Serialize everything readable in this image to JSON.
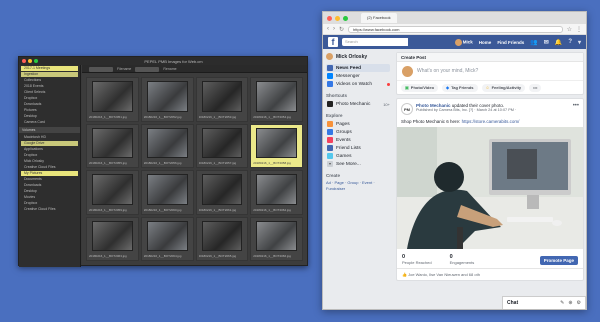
{
  "photo_mechanic": {
    "title": "PEPEL PMB Images for Web.cm",
    "toolbar": [
      "Filename",
      "Rename"
    ],
    "sidebar": [
      {
        "label": "2017-1 Meetings",
        "state": "sel"
      },
      {
        "label": "Ingestion",
        "state": "hl"
      },
      {
        "label": "Collections",
        "state": ""
      },
      {
        "label": "2018 Events",
        "state": ""
      },
      {
        "label": "Client Selects",
        "state": ""
      },
      {
        "label": "Dropbox",
        "state": ""
      },
      {
        "label": "Downloads",
        "state": ""
      },
      {
        "label": "Pictures",
        "state": ""
      },
      {
        "label": "Desktop",
        "state": ""
      },
      {
        "label": "Camera Card",
        "state": ""
      }
    ],
    "sidebar2_header": "Volumes",
    "sidebar2": [
      {
        "label": "Macintosh HD",
        "state": ""
      },
      {
        "label": "Google Drive",
        "state": "hl"
      },
      {
        "label": "Applications",
        "state": ""
      },
      {
        "label": "Dropbox",
        "state": ""
      },
      {
        "label": "Mick Orlosky",
        "state": ""
      },
      {
        "label": "Creative Cloud Files",
        "state": ""
      },
      {
        "label": "My Pictures",
        "state": "sel"
      },
      {
        "label": "Documents",
        "state": ""
      },
      {
        "label": "Downloads",
        "state": ""
      },
      {
        "label": "Desktop",
        "state": ""
      },
      {
        "label": "Movies",
        "state": ""
      },
      {
        "label": "Dropbox",
        "state": ""
      },
      {
        "label": "Creative Cloud Files",
        "state": ""
      }
    ],
    "thumbnails": [
      {
        "cap": "20180216_1__BOT2051.jpg",
        "hl": false
      },
      {
        "cap": "20180216_1__BOT2052.jpg",
        "hl": false
      },
      {
        "cap": "20180216_1__BOT2053.jpg",
        "hl": false
      },
      {
        "cap": "20180216_1__BOT2054.jpg",
        "hl": false
      },
      {
        "cap": "20180216_1__BOT2055.jpg",
        "hl": false
      },
      {
        "cap": "20180216_1__BOT2056.jpg",
        "hl": false
      },
      {
        "cap": "20180216_1__BOT2057.jpg",
        "hl": false
      },
      {
        "cap": "20180216_1__BOT2058.jpg",
        "hl": true
      },
      {
        "cap": "20180216_1__BOT2059.jpg",
        "hl": false
      },
      {
        "cap": "20180216_1__BOT2060.jpg",
        "hl": false
      },
      {
        "cap": "20180216_1__BOT2061.jpg",
        "hl": false
      },
      {
        "cap": "20180216_1__BOT2062.jpg",
        "hl": false
      },
      {
        "cap": "20180216_1__BOT2063.jpg",
        "hl": false
      },
      {
        "cap": "20180216_1__BOT2064.jpg",
        "hl": false
      },
      {
        "cap": "20180216_1__BOT2065.jpg",
        "hl": false
      },
      {
        "cap": "20180216_1__BOT2066.jpg",
        "hl": false
      }
    ]
  },
  "browser": {
    "tab_title": "(2) Facebook",
    "url": "https://www.facebook.com"
  },
  "facebook": {
    "search_placeholder": "Search",
    "nav": {
      "user": "Mick",
      "home": "Home",
      "find_friends": "Find Friends"
    },
    "left": {
      "user": "Mick Orlosky",
      "items": [
        {
          "label": "News Feed",
          "color": "#4267b2",
          "sel": true
        },
        {
          "label": "Messenger",
          "color": "#0084ff",
          "sel": false
        },
        {
          "label": "Videos on Watch",
          "color": "#3578e5",
          "sel": false,
          "dot": true
        }
      ],
      "shortcuts_header": "Shortcuts",
      "shortcuts": [
        {
          "label": "Photo Mechanic",
          "color": "#222",
          "extra": "10+"
        }
      ],
      "explore_header": "Explore",
      "explore": [
        {
          "label": "Pages",
          "color": "#f7923b"
        },
        {
          "label": "Groups",
          "color": "#3578e5"
        },
        {
          "label": "Events",
          "color": "#f3425f"
        },
        {
          "label": "Friend Lists",
          "color": "#4267b2"
        },
        {
          "label": "Games",
          "color": "#54c7ec"
        }
      ],
      "see_more": "See More...",
      "create_header": "Create",
      "create_links": "Ad · Page · Group · Event · Fundraiser"
    },
    "create_post": {
      "header": "Create Post",
      "prompt": "What's on your mind, Mick?",
      "actions": [
        "Photo/Video",
        "Tag Friends",
        "Feeling/Activity"
      ]
    },
    "post": {
      "author": "Photo Mechanic",
      "action": "updated their cover photo.",
      "byline": "Published by Camera Bits, Inc. [?] · March 24 at 10:07 PM · ",
      "text": "Shop Photo Mechanic 6 here:",
      "link": "https://store.camerabits.com/",
      "people_reached_n": "0",
      "people_reached_l": "People Reached",
      "engagements_n": "0",
      "engagements_l": "Engagements",
      "promote": "Promote Page",
      "likes": "Joe Wanio, Ilse Van Nieuwen and 68 oth"
    },
    "chat": "Chat"
  },
  "colors": {
    "desktop": "#4a6fbf",
    "fb_blue": "#3b5998",
    "highlight": "#e9e57c"
  }
}
